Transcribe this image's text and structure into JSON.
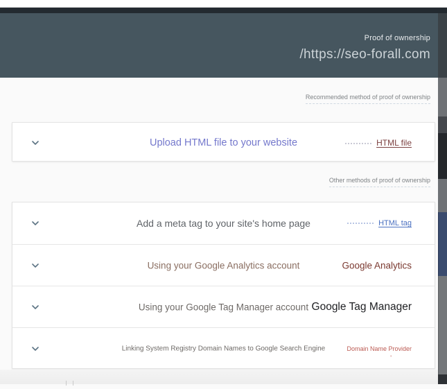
{
  "header": {
    "eyebrow": "Proof of ownership",
    "site_url": "/https://seo-forall.com"
  },
  "sections": {
    "recommended": "Recommended method of proof of ownership",
    "other": "Other methods of proof of ownership"
  },
  "methods": [
    {
      "title": "Upload HTML file to your website",
      "method_label": "HTML file",
      "group": "recommended",
      "title_color": "#7478cc",
      "label_color": "#7b3f3f"
    },
    {
      "title": "Add a meta tag to your site's home page",
      "method_label": "HTML tag",
      "group": "other",
      "title_color": "#5f6368",
      "label_color": "#4a70c0"
    },
    {
      "title": "Using your Google Analytics account",
      "method_label": "Google Analytics",
      "group": "other",
      "title_color": "#8a6e61",
      "label_color": "#7a382f"
    },
    {
      "title": "Using your Google Tag Manager account",
      "method_label": "Google Tag Manager",
      "group": "other",
      "title_color": "#6e6a67",
      "label_color": "#202124"
    },
    {
      "title": "Linking System Registry Domain Names to Google Search Engine",
      "method_label": "Domain Name Provider",
      "group": "other",
      "title_color": "#6e6a67",
      "label_color": "#bb5a52",
      "footnote_mark": "'"
    }
  ],
  "icons": {
    "expand_icon": "chevron-down"
  },
  "colors": {
    "titlebar_bg": "#232a30",
    "header_bg": "#46565f",
    "header_text": "#ccd3d7",
    "body_bg": "#fafafa",
    "card_bg": "#ffffff",
    "card_border": "#e3e3e3",
    "section_label": "#7e8285",
    "chevron": "#5b7383",
    "accent_indigo": "#7478cc",
    "link_blue": "#4a70c0",
    "maroon": "#7b3f3f",
    "provider_red": "#bb5a52"
  }
}
